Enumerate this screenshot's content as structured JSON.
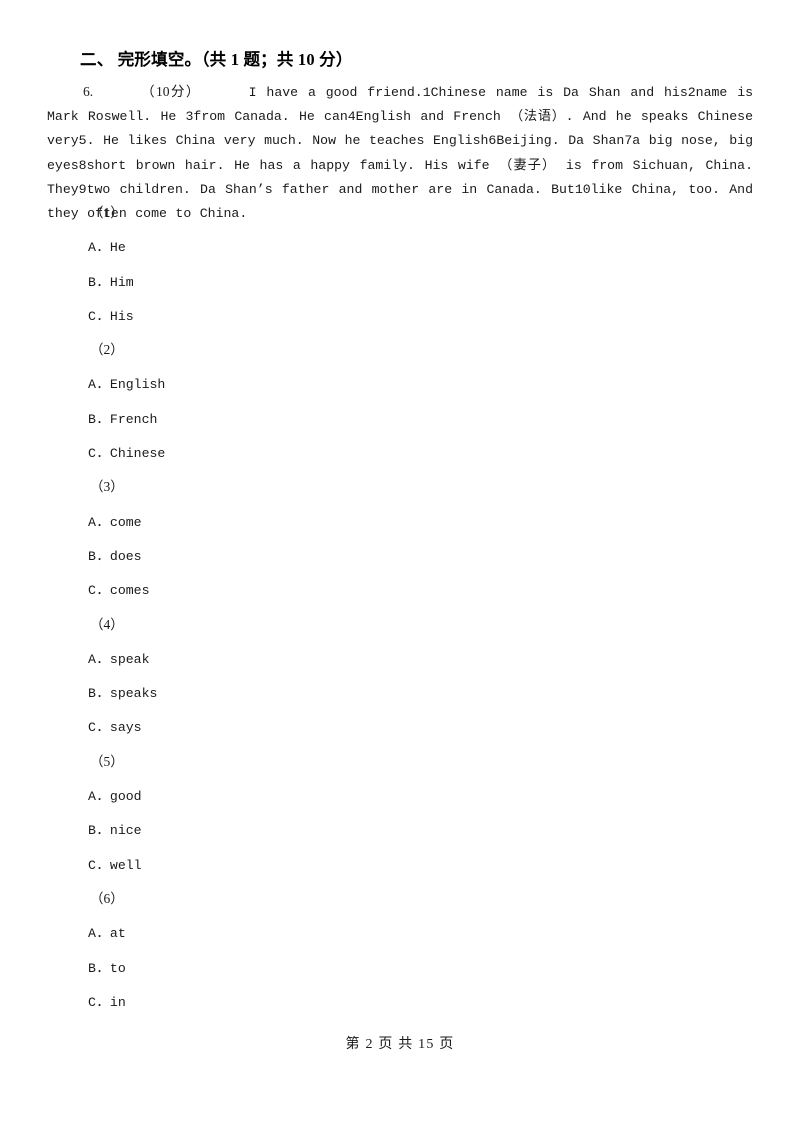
{
  "document": {
    "section_heading": "二、 完形填空。（共 1 题；共 10 分）",
    "footer": "第 2 页 共 15 页"
  },
  "question": {
    "number": "6.",
    "points": "（10分）",
    "passage": "I have a good friend.1Chinese name is Da Shan and his2name is Mark Roswell. He 3from Canada. He can4English and French （法语）. And he speaks Chinese very5. He likes China very much. Now he teaches English6Beijing. Da Shan7a big nose, big eyes8short brown hair. He has a happy family. His wife （妻子） is from Sichuan, China. They9two children. Da Shan’s father and mother are in Canada. But10like China, too. And they often come to China.",
    "option_groups": [
      {
        "index": "（1）",
        "options": [
          {
            "letter": "A",
            "dot": "．",
            "text": "He"
          },
          {
            "letter": "B",
            "dot": "．",
            "text": "Him"
          },
          {
            "letter": "C",
            "dot": "．",
            "text": "His"
          }
        ]
      },
      {
        "index": "（2）",
        "options": [
          {
            "letter": "A",
            "dot": "．",
            "text": "English"
          },
          {
            "letter": "B",
            "dot": "．",
            "text": "French"
          },
          {
            "letter": "C",
            "dot": "．",
            "text": "Chinese"
          }
        ]
      },
      {
        "index": "（3）",
        "options": [
          {
            "letter": "A",
            "dot": "．",
            "text": "come"
          },
          {
            "letter": "B",
            "dot": "．",
            "text": "does"
          },
          {
            "letter": "C",
            "dot": "．",
            "text": "comes"
          }
        ]
      },
      {
        "index": "（4）",
        "options": [
          {
            "letter": "A",
            "dot": "．",
            "text": "speak"
          },
          {
            "letter": "B",
            "dot": "．",
            "text": "speaks"
          },
          {
            "letter": "C",
            "dot": "．",
            "text": "says"
          }
        ]
      },
      {
        "index": "（5）",
        "options": [
          {
            "letter": "A",
            "dot": "．",
            "text": "good"
          },
          {
            "letter": "B",
            "dot": "．",
            "text": "nice"
          },
          {
            "letter": "C",
            "dot": "．",
            "text": "well"
          }
        ]
      },
      {
        "index": "（6）",
        "options": [
          {
            "letter": "A",
            "dot": "．",
            "text": "at"
          },
          {
            "letter": "B",
            "dot": "．",
            "text": "to"
          },
          {
            "letter": "C",
            "dot": "．",
            "text": "in"
          }
        ]
      }
    ]
  }
}
